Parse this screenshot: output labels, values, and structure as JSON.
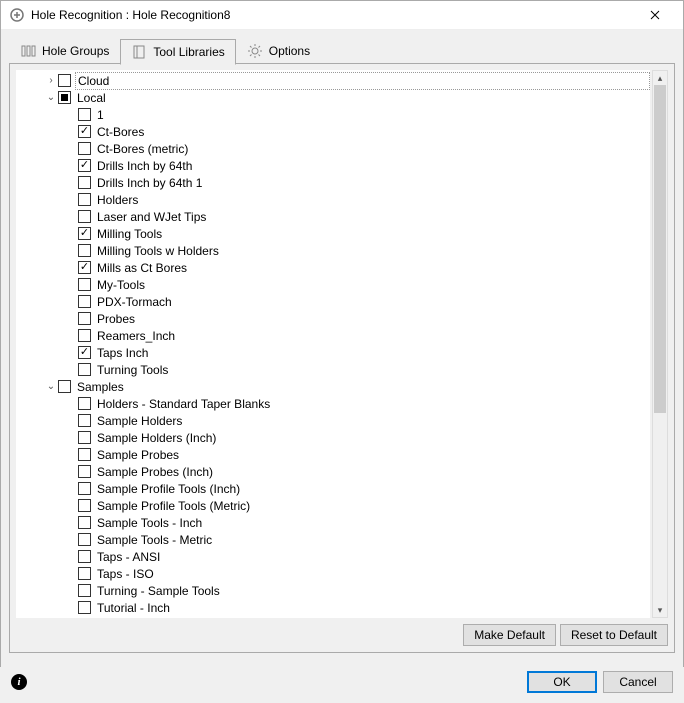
{
  "window": {
    "title": "Hole Recognition : Hole Recognition8"
  },
  "tabs": [
    {
      "label": "Hole Groups"
    },
    {
      "label": "Tool Libraries"
    },
    {
      "label": "Options"
    }
  ],
  "tree": {
    "nodes": [
      {
        "indent": 0,
        "toggle": "collapsed",
        "check": "unchecked",
        "label": "Cloud",
        "first": true
      },
      {
        "indent": 0,
        "toggle": "expanded",
        "check": "mixed",
        "label": "Local"
      },
      {
        "indent": 1,
        "toggle": "",
        "check": "unchecked",
        "label": "1"
      },
      {
        "indent": 1,
        "toggle": "",
        "check": "checked",
        "label": "Ct-Bores"
      },
      {
        "indent": 1,
        "toggle": "",
        "check": "unchecked",
        "label": "Ct-Bores (metric)"
      },
      {
        "indent": 1,
        "toggle": "",
        "check": "checked",
        "label": "Drills Inch by 64th"
      },
      {
        "indent": 1,
        "toggle": "",
        "check": "unchecked",
        "label": "Drills Inch by 64th 1"
      },
      {
        "indent": 1,
        "toggle": "",
        "check": "unchecked",
        "label": "Holders"
      },
      {
        "indent": 1,
        "toggle": "",
        "check": "unchecked",
        "label": "Laser and WJet Tips"
      },
      {
        "indent": 1,
        "toggle": "",
        "check": "checked",
        "label": "Milling Tools"
      },
      {
        "indent": 1,
        "toggle": "",
        "check": "unchecked",
        "label": "Milling Tools w Holders"
      },
      {
        "indent": 1,
        "toggle": "",
        "check": "checked",
        "label": "Mills as Ct Bores"
      },
      {
        "indent": 1,
        "toggle": "",
        "check": "unchecked",
        "label": "My-Tools"
      },
      {
        "indent": 1,
        "toggle": "",
        "check": "unchecked",
        "label": "PDX-Tormach"
      },
      {
        "indent": 1,
        "toggle": "",
        "check": "unchecked",
        "label": "Probes"
      },
      {
        "indent": 1,
        "toggle": "",
        "check": "unchecked",
        "label": "Reamers_Inch"
      },
      {
        "indent": 1,
        "toggle": "",
        "check": "checked",
        "label": "Taps Inch"
      },
      {
        "indent": 1,
        "toggle": "",
        "check": "unchecked",
        "label": "Turning Tools"
      },
      {
        "indent": 0,
        "toggle": "expanded",
        "check": "unchecked",
        "label": "Samples"
      },
      {
        "indent": 1,
        "toggle": "",
        "check": "unchecked",
        "label": "Holders - Standard Taper Blanks"
      },
      {
        "indent": 1,
        "toggle": "",
        "check": "unchecked",
        "label": "Sample Holders"
      },
      {
        "indent": 1,
        "toggle": "",
        "check": "unchecked",
        "label": "Sample Holders (Inch)"
      },
      {
        "indent": 1,
        "toggle": "",
        "check": "unchecked",
        "label": "Sample Probes"
      },
      {
        "indent": 1,
        "toggle": "",
        "check": "unchecked",
        "label": "Sample Probes (Inch)"
      },
      {
        "indent": 1,
        "toggle": "",
        "check": "unchecked",
        "label": "Sample Profile Tools (Inch)"
      },
      {
        "indent": 1,
        "toggle": "",
        "check": "unchecked",
        "label": "Sample Profile Tools (Metric)"
      },
      {
        "indent": 1,
        "toggle": "",
        "check": "unchecked",
        "label": "Sample Tools - Inch"
      },
      {
        "indent": 1,
        "toggle": "",
        "check": "unchecked",
        "label": "Sample Tools - Metric"
      },
      {
        "indent": 1,
        "toggle": "",
        "check": "unchecked",
        "label": "Taps - ANSI"
      },
      {
        "indent": 1,
        "toggle": "",
        "check": "unchecked",
        "label": "Taps - ISO"
      },
      {
        "indent": 1,
        "toggle": "",
        "check": "unchecked",
        "label": "Turning - Sample Tools"
      },
      {
        "indent": 1,
        "toggle": "",
        "check": "unchecked",
        "label": "Tutorial - Inch"
      }
    ]
  },
  "buttons": {
    "make_default": "Make Default",
    "reset_default": "Reset to Default",
    "ok": "OK",
    "cancel": "Cancel"
  }
}
